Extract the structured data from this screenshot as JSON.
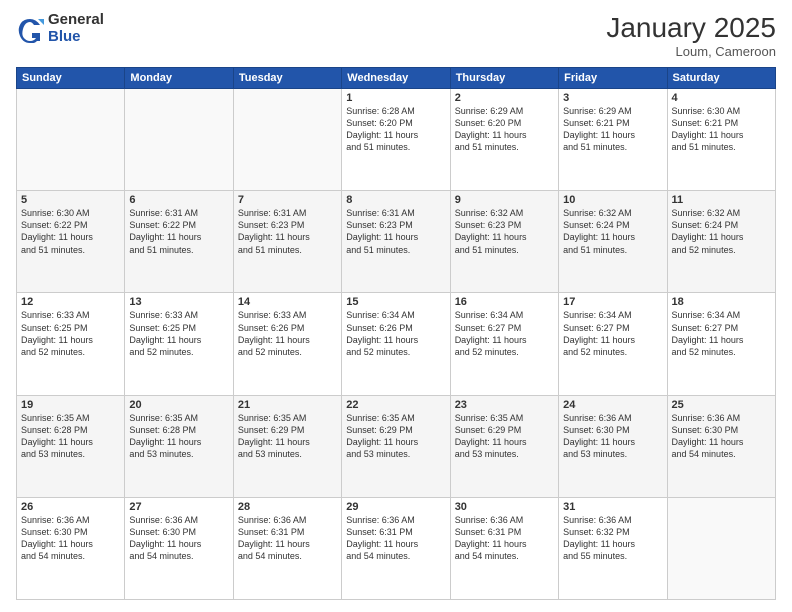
{
  "header": {
    "logo_general": "General",
    "logo_blue": "Blue",
    "month_title": "January 2025",
    "location": "Loum, Cameroon"
  },
  "weekdays": [
    "Sunday",
    "Monday",
    "Tuesday",
    "Wednesday",
    "Thursday",
    "Friday",
    "Saturday"
  ],
  "weeks": [
    [
      {
        "day": "",
        "info": ""
      },
      {
        "day": "",
        "info": ""
      },
      {
        "day": "",
        "info": ""
      },
      {
        "day": "1",
        "info": "Sunrise: 6:28 AM\nSunset: 6:20 PM\nDaylight: 11 hours\nand 51 minutes."
      },
      {
        "day": "2",
        "info": "Sunrise: 6:29 AM\nSunset: 6:20 PM\nDaylight: 11 hours\nand 51 minutes."
      },
      {
        "day": "3",
        "info": "Sunrise: 6:29 AM\nSunset: 6:21 PM\nDaylight: 11 hours\nand 51 minutes."
      },
      {
        "day": "4",
        "info": "Sunrise: 6:30 AM\nSunset: 6:21 PM\nDaylight: 11 hours\nand 51 minutes."
      }
    ],
    [
      {
        "day": "5",
        "info": "Sunrise: 6:30 AM\nSunset: 6:22 PM\nDaylight: 11 hours\nand 51 minutes."
      },
      {
        "day": "6",
        "info": "Sunrise: 6:31 AM\nSunset: 6:22 PM\nDaylight: 11 hours\nand 51 minutes."
      },
      {
        "day": "7",
        "info": "Sunrise: 6:31 AM\nSunset: 6:23 PM\nDaylight: 11 hours\nand 51 minutes."
      },
      {
        "day": "8",
        "info": "Sunrise: 6:31 AM\nSunset: 6:23 PM\nDaylight: 11 hours\nand 51 minutes."
      },
      {
        "day": "9",
        "info": "Sunrise: 6:32 AM\nSunset: 6:23 PM\nDaylight: 11 hours\nand 51 minutes."
      },
      {
        "day": "10",
        "info": "Sunrise: 6:32 AM\nSunset: 6:24 PM\nDaylight: 11 hours\nand 51 minutes."
      },
      {
        "day": "11",
        "info": "Sunrise: 6:32 AM\nSunset: 6:24 PM\nDaylight: 11 hours\nand 52 minutes."
      }
    ],
    [
      {
        "day": "12",
        "info": "Sunrise: 6:33 AM\nSunset: 6:25 PM\nDaylight: 11 hours\nand 52 minutes."
      },
      {
        "day": "13",
        "info": "Sunrise: 6:33 AM\nSunset: 6:25 PM\nDaylight: 11 hours\nand 52 minutes."
      },
      {
        "day": "14",
        "info": "Sunrise: 6:33 AM\nSunset: 6:26 PM\nDaylight: 11 hours\nand 52 minutes."
      },
      {
        "day": "15",
        "info": "Sunrise: 6:34 AM\nSunset: 6:26 PM\nDaylight: 11 hours\nand 52 minutes."
      },
      {
        "day": "16",
        "info": "Sunrise: 6:34 AM\nSunset: 6:27 PM\nDaylight: 11 hours\nand 52 minutes."
      },
      {
        "day": "17",
        "info": "Sunrise: 6:34 AM\nSunset: 6:27 PM\nDaylight: 11 hours\nand 52 minutes."
      },
      {
        "day": "18",
        "info": "Sunrise: 6:34 AM\nSunset: 6:27 PM\nDaylight: 11 hours\nand 52 minutes."
      }
    ],
    [
      {
        "day": "19",
        "info": "Sunrise: 6:35 AM\nSunset: 6:28 PM\nDaylight: 11 hours\nand 53 minutes."
      },
      {
        "day": "20",
        "info": "Sunrise: 6:35 AM\nSunset: 6:28 PM\nDaylight: 11 hours\nand 53 minutes."
      },
      {
        "day": "21",
        "info": "Sunrise: 6:35 AM\nSunset: 6:29 PM\nDaylight: 11 hours\nand 53 minutes."
      },
      {
        "day": "22",
        "info": "Sunrise: 6:35 AM\nSunset: 6:29 PM\nDaylight: 11 hours\nand 53 minutes."
      },
      {
        "day": "23",
        "info": "Sunrise: 6:35 AM\nSunset: 6:29 PM\nDaylight: 11 hours\nand 53 minutes."
      },
      {
        "day": "24",
        "info": "Sunrise: 6:36 AM\nSunset: 6:30 PM\nDaylight: 11 hours\nand 53 minutes."
      },
      {
        "day": "25",
        "info": "Sunrise: 6:36 AM\nSunset: 6:30 PM\nDaylight: 11 hours\nand 54 minutes."
      }
    ],
    [
      {
        "day": "26",
        "info": "Sunrise: 6:36 AM\nSunset: 6:30 PM\nDaylight: 11 hours\nand 54 minutes."
      },
      {
        "day": "27",
        "info": "Sunrise: 6:36 AM\nSunset: 6:30 PM\nDaylight: 11 hours\nand 54 minutes."
      },
      {
        "day": "28",
        "info": "Sunrise: 6:36 AM\nSunset: 6:31 PM\nDaylight: 11 hours\nand 54 minutes."
      },
      {
        "day": "29",
        "info": "Sunrise: 6:36 AM\nSunset: 6:31 PM\nDaylight: 11 hours\nand 54 minutes."
      },
      {
        "day": "30",
        "info": "Sunrise: 6:36 AM\nSunset: 6:31 PM\nDaylight: 11 hours\nand 54 minutes."
      },
      {
        "day": "31",
        "info": "Sunrise: 6:36 AM\nSunset: 6:32 PM\nDaylight: 11 hours\nand 55 minutes."
      },
      {
        "day": "",
        "info": ""
      }
    ]
  ]
}
